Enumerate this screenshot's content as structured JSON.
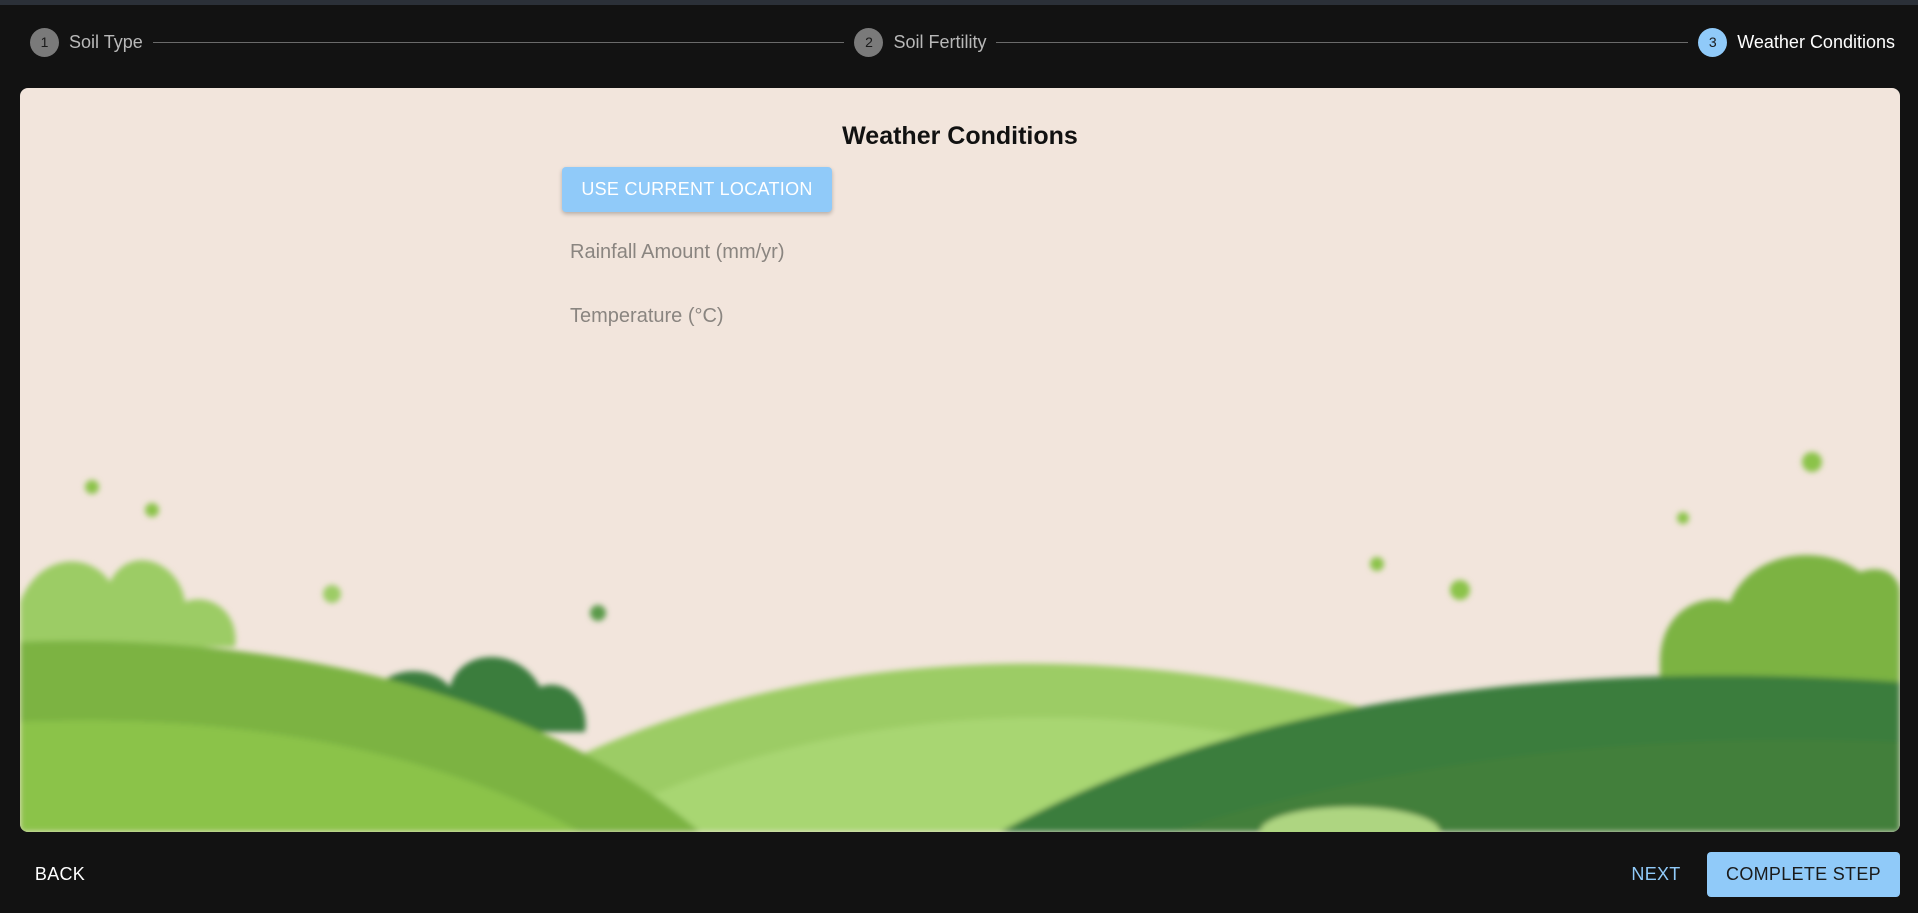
{
  "stepper": {
    "steps": [
      {
        "number": "1",
        "label": "Soil Type",
        "state": "completed"
      },
      {
        "number": "2",
        "label": "Soil Fertility",
        "state": "completed"
      },
      {
        "number": "3",
        "label": "Weather Conditions",
        "state": "active"
      }
    ]
  },
  "card": {
    "title": "Weather Conditions",
    "location_button": "USE CURRENT LOCATION",
    "rainfall": {
      "value": "",
      "placeholder": "Rainfall Amount (mm/yr)"
    },
    "temperature": {
      "value": "",
      "placeholder": "Temperature (°C)"
    }
  },
  "footer": {
    "back_label": "BACK",
    "next_label": "NEXT",
    "complete_label": "COMPLETE STEP"
  },
  "colors": {
    "background": "#121212",
    "card": "#f2e5dc",
    "accent": "#90caf9",
    "hill_light": "#a3cf6a",
    "hill_mid": "#7cb342",
    "hill_dark": "#3a7d3c"
  }
}
